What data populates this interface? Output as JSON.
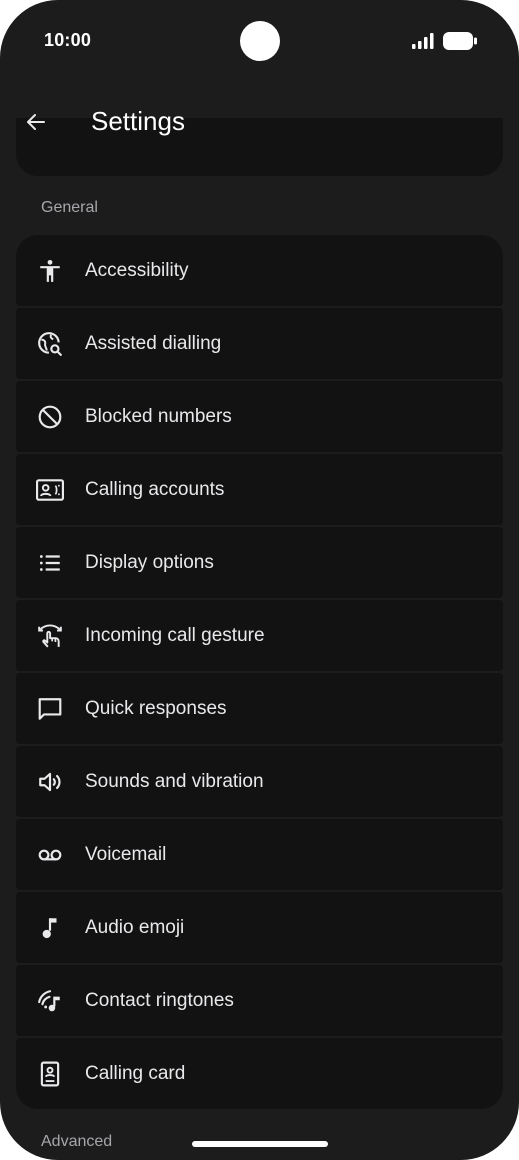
{
  "status_bar": {
    "time": "10:00"
  },
  "header": {
    "title": "Settings"
  },
  "sections": [
    {
      "label": "General"
    },
    {
      "label": "Advanced"
    }
  ],
  "items": [
    {
      "label": "Accessibility",
      "icon": "accessibility-icon"
    },
    {
      "label": "Assisted dialling",
      "icon": "globe-search-icon"
    },
    {
      "label": "Blocked numbers",
      "icon": "block-icon"
    },
    {
      "label": "Calling accounts",
      "icon": "contact-card-icon"
    },
    {
      "label": "Display options",
      "icon": "list-icon"
    },
    {
      "label": "Incoming call gesture",
      "icon": "swipe-gesture-icon"
    },
    {
      "label": "Quick responses",
      "icon": "message-icon"
    },
    {
      "label": "Sounds and vibration",
      "icon": "volume-icon"
    },
    {
      "label": "Voicemail",
      "icon": "voicemail-icon"
    },
    {
      "label": "Audio emoji",
      "icon": "music-note-icon"
    },
    {
      "label": "Contact ringtones",
      "icon": "ringtone-icon"
    },
    {
      "label": "Calling card",
      "icon": "calling-card-icon"
    }
  ],
  "colors": {
    "background": "#1c1c1d",
    "card": "#121213",
    "text": "#e9e9ec",
    "secondary_text": "#a6a6ab"
  }
}
